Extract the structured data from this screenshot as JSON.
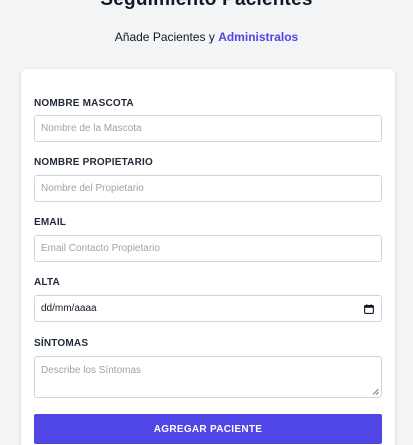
{
  "header": {
    "title": "Seguimiento Pacientes",
    "subtitle_prefix": "Añade Pacientes y ",
    "subtitle_accent": "Administralos"
  },
  "form": {
    "mascota": {
      "label": "NOMBRE MASCOTA",
      "placeholder": "Nombre de la Mascota"
    },
    "propietario": {
      "label": "NOMBRE PROPIETARIO",
      "placeholder": "Nombre del Propietario"
    },
    "email": {
      "label": "EMAIL",
      "placeholder": "Email Contacto Propietario"
    },
    "alta": {
      "label": "ALTA",
      "value": "dd/mm/aaaa",
      "icon": "calendar-icon"
    },
    "sintomas": {
      "label": "SÍNTOMAS",
      "placeholder": "Describe los Síntomas"
    },
    "submit_label": "AGREGAR PACIENTE"
  },
  "colors": {
    "accent": "#4f46e5",
    "background": "#f3f4f6",
    "card": "#ffffff"
  }
}
